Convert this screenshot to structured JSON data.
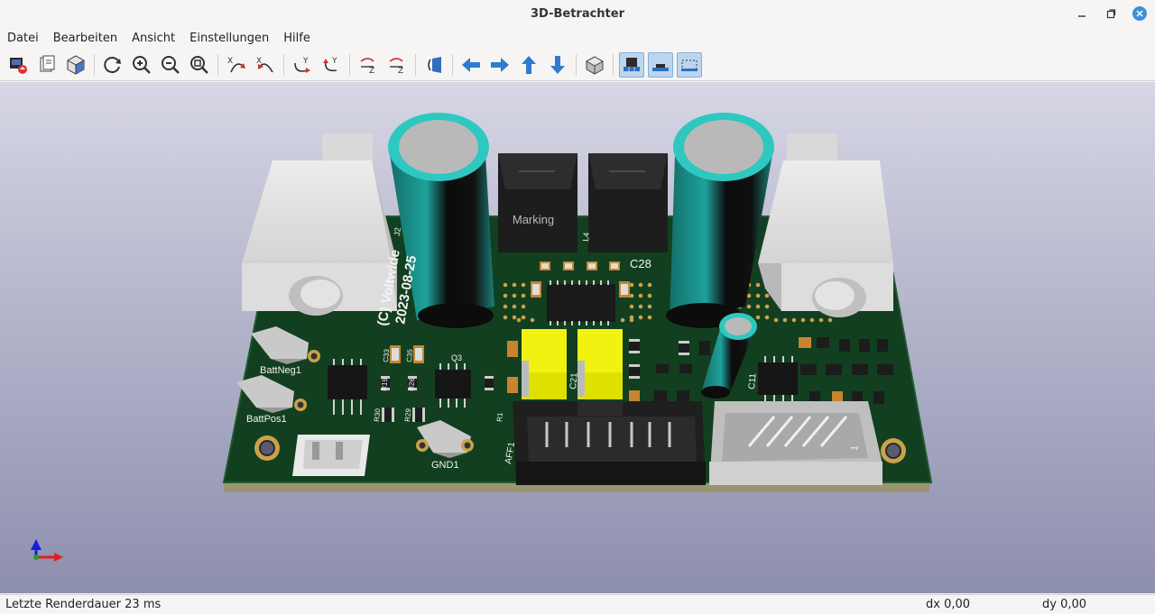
{
  "window": {
    "title": "3D-Betrachter"
  },
  "menu": [
    "Datei",
    "Bearbeiten",
    "Ansicht",
    "Einstellungen",
    "Hilfe"
  ],
  "toolbar": {
    "buttons": [
      {
        "icon": "export-image-icon"
      },
      {
        "icon": "copy-to-clipboard-icon"
      },
      {
        "icon": "render-raytrace-icon"
      },
      {
        "sep": true
      },
      {
        "icon": "reload-icon"
      },
      {
        "icon": "zoom-in-icon"
      },
      {
        "icon": "zoom-out-icon"
      },
      {
        "icon": "zoom-fit-icon"
      },
      {
        "sep": true
      },
      {
        "icon": "rotate-x-cw-icon"
      },
      {
        "icon": "rotate-x-ccw-icon"
      },
      {
        "sep": true
      },
      {
        "icon": "rotate-y-cw-icon"
      },
      {
        "icon": "rotate-y-ccw-icon"
      },
      {
        "sep": true
      },
      {
        "icon": "rotate-z-cw-icon"
      },
      {
        "icon": "rotate-z-ccw-icon"
      },
      {
        "sep": true
      },
      {
        "icon": "flip-board-icon"
      },
      {
        "sep": true
      },
      {
        "icon": "move-left-icon"
      },
      {
        "icon": "move-right-icon"
      },
      {
        "icon": "move-up-icon"
      },
      {
        "icon": "move-down-icon"
      },
      {
        "sep": true
      },
      {
        "icon": "view-3d-icon"
      },
      {
        "sep": true
      },
      {
        "icon": "show-tht-icon",
        "active": true
      },
      {
        "icon": "show-smd-icon",
        "active": true
      },
      {
        "icon": "show-virtual-icon",
        "active": true
      }
    ]
  },
  "board": {
    "silk_copyright": "(C) Voltwide",
    "silk_date": "2023-08-25",
    "inductor_marking": "Marking",
    "labels": {
      "j2": "J2",
      "l4": "L4",
      "c28": "C28",
      "battneg": "BattNeg1",
      "battpos": "BattPos1",
      "gnd": "GND1",
      "aff1": "AFF1",
      "c21": "C21",
      "q3": "Q3",
      "c33": "C33",
      "c35": "C35",
      "r19": "R19",
      "r26": "R26",
      "r30": "R30",
      "r29": "R29",
      "r1": "R1",
      "c11": "C11",
      "one": "1"
    }
  },
  "status": {
    "render_time": "Letzte Renderdauer 23 ms",
    "dx": "dx 0,00",
    "dy": "dy 0,00"
  }
}
